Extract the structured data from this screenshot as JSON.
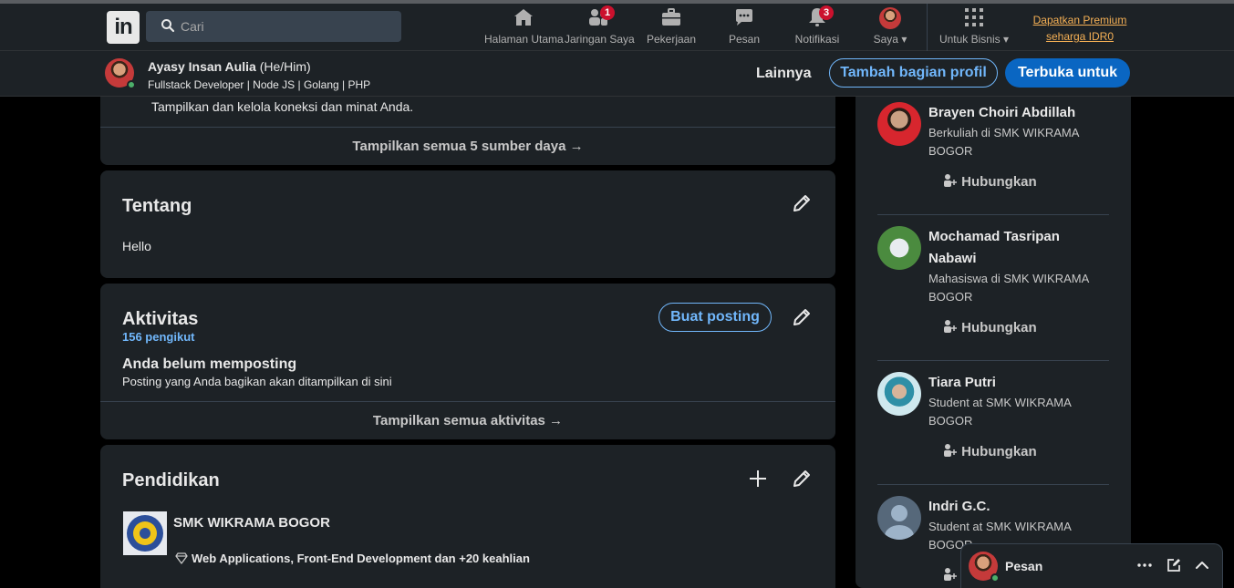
{
  "nav": {
    "logo_text": "in",
    "search_placeholder": "Cari",
    "items": [
      {
        "label": "Halaman Utama",
        "icon": "home-icon"
      },
      {
        "label": "Jaringan Saya",
        "icon": "network-icon",
        "badge": "1"
      },
      {
        "label": "Pekerjaan",
        "icon": "briefcase-icon"
      },
      {
        "label": "Pesan",
        "icon": "messaging-icon"
      },
      {
        "label": "Notifikasi",
        "icon": "bell-icon",
        "badge": "3"
      },
      {
        "label": "Saya",
        "icon": "avatar"
      },
      {
        "label": "Untuk Bisnis",
        "icon": "grid-icon"
      }
    ],
    "premium_line1": "Dapatkan Premium",
    "premium_line2": "seharga IDR0"
  },
  "profile_bar": {
    "name": "Ayasy Insan Aulia",
    "pronouns": "(He/Him)",
    "headline": "Fullstack Developer | Node JS | Golang | PHP",
    "more": "Lainnya",
    "add_section": "Tambah bagian profil",
    "open_to": "Terbuka untuk"
  },
  "resources_card": {
    "text": "Tampilkan dan kelola koneksi dan minat Anda.",
    "footer": "Tampilkan semua 5 sumber daya →"
  },
  "about_card": {
    "title": "Tentang",
    "body": "Hello"
  },
  "activity_card": {
    "title": "Aktivitas",
    "followers": "156 pengikut",
    "create_post": "Buat posting",
    "empty_title": "Anda belum memposting",
    "empty_desc": "Posting yang Anda bagikan akan ditampilkan di sini",
    "footer": "Tampilkan semua aktivitas →"
  },
  "education_card": {
    "title": "Pendidikan",
    "school": "SMK WIKRAMA BOGOR",
    "skills": "Web Applications, Front-End Development dan +20 keahlian"
  },
  "sidebar": {
    "connect_label": "Hubungkan",
    "people": [
      {
        "name": "Brayen Choiri Abdillah",
        "headline": "Berkuliah di SMK WIKRAMA BOGOR"
      },
      {
        "name": "Mochamad Tasripan Nabawi",
        "headline": "Mahasiswa di SMK WIKRAMA BOGOR"
      },
      {
        "name": "Tiara Putri",
        "headline": "Student at SMK WIKRAMA BOGOR"
      },
      {
        "name": "Indri G.C.",
        "headline": "Student at SMK WIKRAMA BOGOR"
      }
    ]
  },
  "messaging": {
    "label": "Pesan"
  },
  "colors": {
    "bg": "#000000",
    "card": "#1d2226",
    "accent": "#71b7fb",
    "primary": "#0a66c2",
    "badge": "#cb112d",
    "premium": "#f5b055"
  }
}
